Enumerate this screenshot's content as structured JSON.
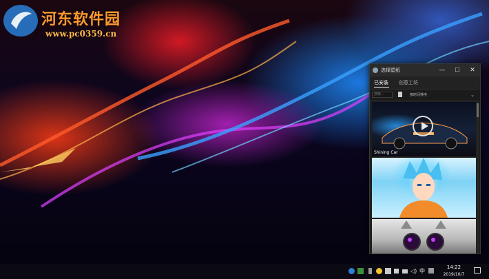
{
  "watermark": {
    "title": "河东软件园",
    "url": "www.pc0359.cn"
  },
  "window": {
    "title": "选择壁纸",
    "controls": {
      "minimize": "—",
      "maximize": "☐",
      "close": "✕"
    },
    "tabs": [
      {
        "label": "已安装",
        "active": true
      },
      {
        "label": "创意工坊",
        "active": false
      }
    ],
    "search_placeholder": "搜索...",
    "sort_value": "按时间排序",
    "wallpapers": [
      {
        "label": "Shining Car"
      },
      {
        "label": ""
      },
      {
        "label": ""
      }
    ]
  },
  "taskbar": {
    "ime": "中",
    "tray_symbol": "◁)",
    "time": "14:22",
    "date": "2019/10/7"
  },
  "colors": {
    "window_bg": "#1f1f1f",
    "watermark": "#ff9a2e"
  }
}
